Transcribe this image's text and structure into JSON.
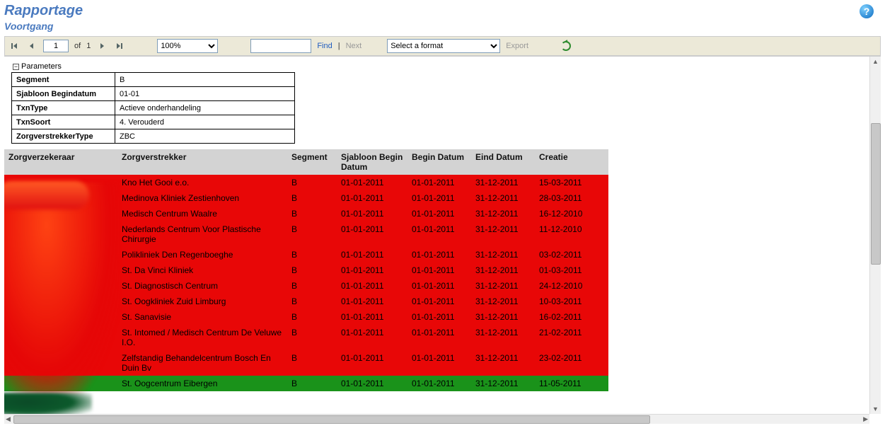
{
  "header": {
    "title": "Rapportage",
    "subtitle": "Voortgang"
  },
  "toolbar": {
    "page_current": "1",
    "of_label": "of",
    "page_total": "1",
    "zoom": "100%",
    "find_label": "Find",
    "sep": "|",
    "next_label": "Next",
    "format_placeholder": "Select a format",
    "export_label": "Export"
  },
  "parameters": {
    "heading": "Parameters",
    "rows": [
      {
        "label": "Segment",
        "value": "B"
      },
      {
        "label": "Sjabloon Begindatum",
        "value": "01-01"
      },
      {
        "label": "TxnType",
        "value": "Actieve onderhandeling"
      },
      {
        "label": "TxnSoort",
        "value": "4. Verouderd"
      },
      {
        "label": "ZorgverstrekkerType",
        "value": "ZBC"
      }
    ]
  },
  "table": {
    "columns": [
      "Zorgverzekeraar",
      "Zorgverstrekker",
      "Segment",
      "Sjabloon Begin Datum",
      "Begin Datum",
      "Eind Datum",
      "Creatie"
    ],
    "rows": [
      {
        "status": "red",
        "zorgverzekeraar": "",
        "zorgverstrekker": "Kno Het Gooi e.o.",
        "segment": "B",
        "sjabloon_begin": "01-01-2011",
        "begin": "01-01-2011",
        "eind": "31-12-2011",
        "creatie": "15-03-2011"
      },
      {
        "status": "red",
        "zorgverzekeraar": "",
        "zorgverstrekker": "Medinova Kliniek Zestienhoven",
        "segment": "B",
        "sjabloon_begin": "01-01-2011",
        "begin": "01-01-2011",
        "eind": "31-12-2011",
        "creatie": "28-03-2011"
      },
      {
        "status": "red",
        "zorgverzekeraar": "",
        "zorgverstrekker": "Medisch Centrum Waalre",
        "segment": "B",
        "sjabloon_begin": "01-01-2011",
        "begin": "01-01-2011",
        "eind": "31-12-2011",
        "creatie": "16-12-2010"
      },
      {
        "status": "red",
        "zorgverzekeraar": "",
        "zorgverstrekker": "Nederlands Centrum Voor Plastische Chirurgie",
        "segment": "B",
        "sjabloon_begin": "01-01-2011",
        "begin": "01-01-2011",
        "eind": "31-12-2011",
        "creatie": "11-12-2010"
      },
      {
        "status": "red",
        "zorgverzekeraar": "",
        "zorgverstrekker": "Polikliniek Den Regenboeghe",
        "segment": "B",
        "sjabloon_begin": "01-01-2011",
        "begin": "01-01-2011",
        "eind": "31-12-2011",
        "creatie": "03-02-2011"
      },
      {
        "status": "red",
        "zorgverzekeraar": "",
        "zorgverstrekker": "St. Da Vinci Kliniek",
        "segment": "B",
        "sjabloon_begin": "01-01-2011",
        "begin": "01-01-2011",
        "eind": "31-12-2011",
        "creatie": "01-03-2011"
      },
      {
        "status": "red",
        "zorgverzekeraar": "",
        "zorgverstrekker": "St. Diagnostisch Centrum",
        "segment": "B",
        "sjabloon_begin": "01-01-2011",
        "begin": "01-01-2011",
        "eind": "31-12-2011",
        "creatie": "24-12-2010"
      },
      {
        "status": "red",
        "zorgverzekeraar": "",
        "zorgverstrekker": "St. Oogkliniek Zuid Limburg",
        "segment": "B",
        "sjabloon_begin": "01-01-2011",
        "begin": "01-01-2011",
        "eind": "31-12-2011",
        "creatie": "10-03-2011"
      },
      {
        "status": "red",
        "zorgverzekeraar": "",
        "zorgverstrekker": "St. Sanavisie",
        "segment": "B",
        "sjabloon_begin": "01-01-2011",
        "begin": "01-01-2011",
        "eind": "31-12-2011",
        "creatie": "16-02-2011"
      },
      {
        "status": "red",
        "zorgverzekeraar": "",
        "zorgverstrekker": "St. Intomed / Medisch Centrum De Veluwe I.O.",
        "segment": "B",
        "sjabloon_begin": "01-01-2011",
        "begin": "01-01-2011",
        "eind": "31-12-2011",
        "creatie": "21-02-2011"
      },
      {
        "status": "red",
        "zorgverzekeraar": "",
        "zorgverstrekker": "Zelfstandig Behandelcentrum Bosch En Duin Bv",
        "segment": "B",
        "sjabloon_begin": "01-01-2011",
        "begin": "01-01-2011",
        "eind": "31-12-2011",
        "creatie": "23-02-2011"
      },
      {
        "status": "green",
        "zorgverzekeraar": "",
        "zorgverstrekker": "St. Oogcentrum Eibergen",
        "segment": "B",
        "sjabloon_begin": "01-01-2011",
        "begin": "01-01-2011",
        "eind": "31-12-2011",
        "creatie": "11-05-2011"
      }
    ]
  }
}
